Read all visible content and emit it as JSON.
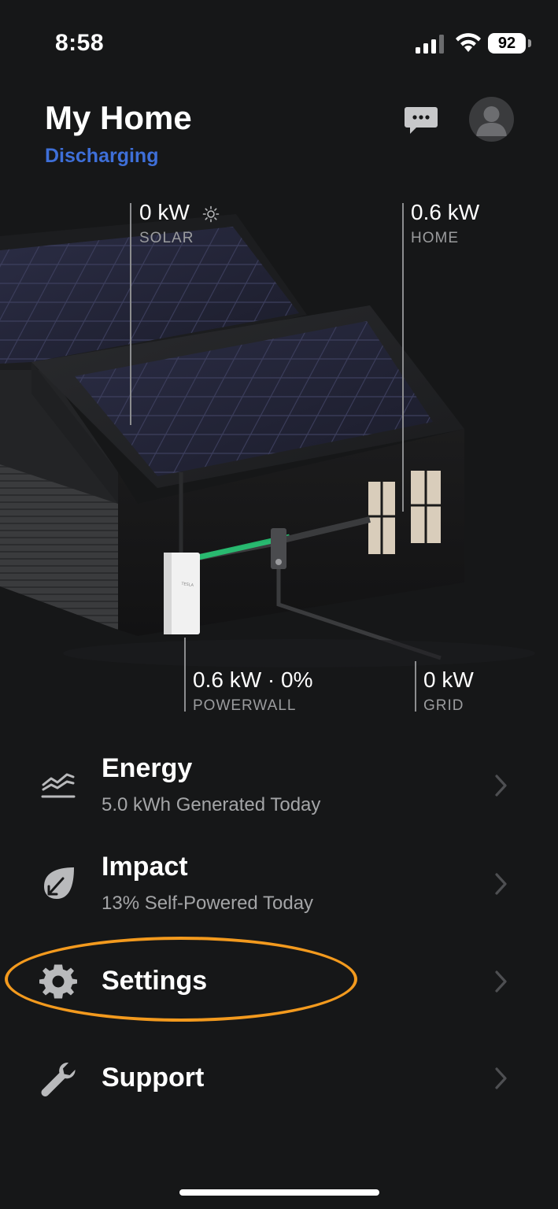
{
  "status_bar": {
    "time": "8:58",
    "battery_level": "92",
    "signal_icon": "cellular-signal-icon",
    "wifi_icon": "wifi-icon"
  },
  "header": {
    "title": "My Home",
    "status": "Discharging",
    "status_color": "#3e6fd8",
    "chat_icon": "chat-bubble-icon",
    "profile_icon": "avatar-icon"
  },
  "energy_flow": {
    "solar": {
      "value": "0 kW",
      "label": "SOLAR",
      "icon": "sun-icon"
    },
    "home": {
      "value": "0.6 kW",
      "label": "HOME"
    },
    "powerwall": {
      "value": "0.6 kW · 0%",
      "label": "POWERWALL",
      "flow_color": "#27d07a"
    },
    "grid": {
      "value": "0 kW",
      "label": "GRID"
    },
    "powerwall_brand": "TESLA"
  },
  "menu": [
    {
      "title": "Energy",
      "subtitle": "5.0 kWh Generated Today",
      "icon": "energy-chart-icon"
    },
    {
      "title": "Impact",
      "subtitle": "13% Self-Powered Today",
      "icon": "leaf-icon"
    },
    {
      "title": "Settings",
      "subtitle": "",
      "icon": "gear-icon",
      "highlighted": true,
      "highlight_color": "#f39a1e"
    },
    {
      "title": "Support",
      "subtitle": "",
      "icon": "wrench-icon"
    }
  ]
}
